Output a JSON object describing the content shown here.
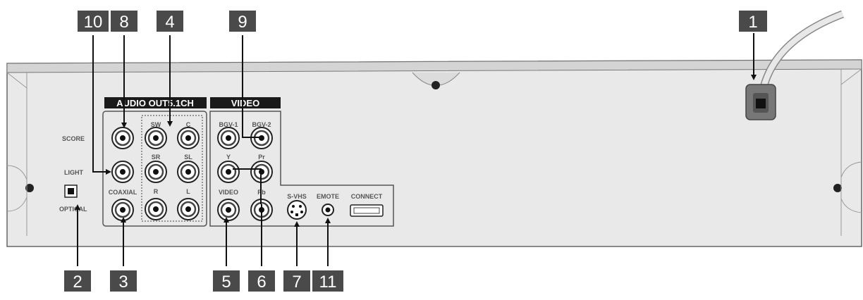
{
  "callouts": {
    "c1": "1",
    "c2": "2",
    "c3": "3",
    "c4": "4",
    "c5": "5",
    "c6": "6",
    "c7": "7",
    "c8": "8",
    "c9": "9",
    "c10": "10",
    "c11": "11"
  },
  "sections": {
    "audio_out": "AUDIO OUT5.1CH",
    "video": "VIDEO"
  },
  "side_labels": {
    "score": "SCORE",
    "light": "LIGHT",
    "optical": "OPTICAL"
  },
  "jack_labels": {
    "coaxial": "COAXIAL",
    "sw": "SW",
    "c": "C",
    "sr": "SR",
    "sl": "SL",
    "r": "R",
    "l": "L",
    "bgv1": "BGV-1",
    "bgv2": "BGV-2",
    "y": "Y",
    "pr": "Pr",
    "video": "VIDEO",
    "pb": "Pb",
    "svhs": "S-VHS",
    "emote": "EMOTE",
    "connect": "CONNECT"
  },
  "colors": {
    "panel": "#e9e9e9",
    "callout_box": "#4a4a4a",
    "header_bar": "#1a1a1a"
  }
}
